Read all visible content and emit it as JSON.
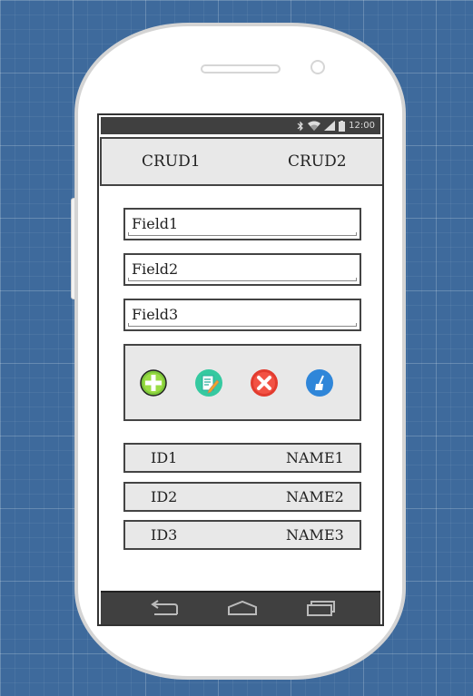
{
  "status_bar": {
    "time": "12:00",
    "icons": [
      "bluetooth-icon",
      "wifi-icon",
      "signal-icon",
      "battery-icon"
    ]
  },
  "tabs": [
    {
      "label": "CRUD1"
    },
    {
      "label": "CRUD2"
    }
  ],
  "fields": [
    {
      "value": "Field1"
    },
    {
      "value": "Field2"
    },
    {
      "value": "Field3"
    }
  ],
  "toolbar": {
    "actions": [
      "add-icon",
      "edit-icon",
      "delete-icon",
      "clear-icon"
    ]
  },
  "rows": [
    {
      "id": "ID1",
      "name": "NAME1"
    },
    {
      "id": "ID2",
      "name": "NAME2"
    },
    {
      "id": "ID3",
      "name": "NAME3"
    }
  ],
  "nav_bar": {
    "buttons": [
      "back-icon",
      "home-icon",
      "recents-icon"
    ]
  }
}
